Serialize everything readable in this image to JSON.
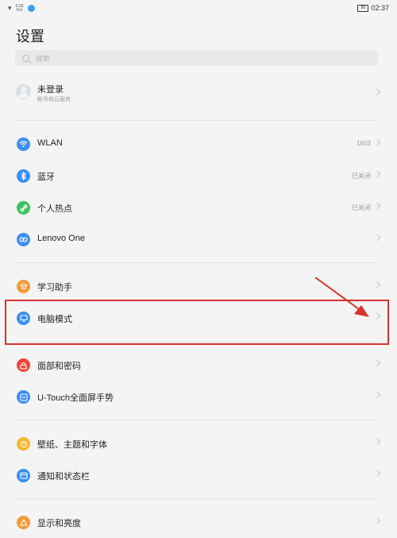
{
  "status_bar": {
    "net_speed": "0.00 K/s",
    "time": "02:37",
    "battery": "80"
  },
  "title": "设置",
  "search": {
    "placeholder": "搜索"
  },
  "account": {
    "name": "未登录",
    "subtitle": "帐号和云服务"
  },
  "groups": [
    [
      {
        "label": "WLAN",
        "value": "1603",
        "icon": "wifi-icon",
        "color": "#3a8ff0"
      },
      {
        "label": "蓝牙",
        "value": "已关闭",
        "icon": "bluetooth-icon",
        "color": "#3a8ff0"
      },
      {
        "label": "个人热点",
        "value": "已关闭",
        "icon": "hotspot-icon",
        "color": "#3cc15c"
      },
      {
        "label": "Lenovo One",
        "value": "",
        "icon": "lenovo-one-icon",
        "color": "#3a8ff0"
      }
    ],
    [
      {
        "label": "学习助手",
        "value": "",
        "icon": "study-assistant-icon",
        "color": "#f49a38"
      },
      {
        "label": "电脑模式",
        "value": "",
        "icon": "pc-mode-icon",
        "color": "#3a8ff0"
      }
    ],
    [
      {
        "label": "面部和密码",
        "value": "",
        "icon": "lock-icon",
        "color": "#f0463c"
      },
      {
        "label": "U-Touch全面屏手势",
        "value": "",
        "icon": "gesture-icon",
        "color": "#3a8ff0"
      }
    ],
    [
      {
        "label": "壁纸、主题和字体",
        "value": "",
        "icon": "wallpaper-icon",
        "color": "#f5b82e"
      },
      {
        "label": "通知和状态栏",
        "value": "",
        "icon": "notification-icon",
        "color": "#3a8ff0"
      }
    ],
    [
      {
        "label": "显示和亮度",
        "value": "",
        "icon": "display-icon",
        "color": "#f49a38"
      }
    ]
  ],
  "annotation": {
    "highlight_color": "#d8332b"
  }
}
